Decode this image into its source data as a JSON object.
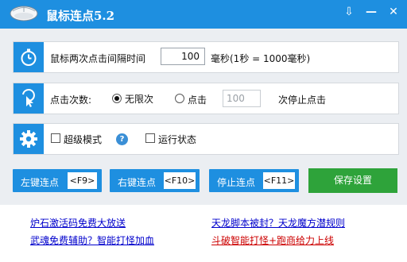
{
  "window": {
    "title": "鼠标连点5.2",
    "controls": {
      "pin": "⇩",
      "minimize": "—",
      "close": "✕"
    }
  },
  "interval": {
    "label": "鼠标两次点击间隔时间",
    "value": "100",
    "unit_label": "毫秒(1秒 = 1000毫秒)"
  },
  "clicks": {
    "label": "点击次数:",
    "unlimited_label": "无限次",
    "limited_label": "点击",
    "count_value": "100",
    "suffix_label": "次停止点击",
    "selected": "unlimited"
  },
  "modes": {
    "super_mode_label": "超级模式",
    "help_glyph": "?",
    "run_state_label": "运行状态",
    "super_mode_checked": false,
    "run_state_checked": false
  },
  "buttons": {
    "left": {
      "label": "左键连点",
      "key": "<F9>"
    },
    "right": {
      "label": "右键连点",
      "key": "<F10>"
    },
    "stop": {
      "label": "停止连点",
      "key": "<F11>"
    },
    "save": {
      "label": "保存设置"
    }
  },
  "links": {
    "l1": "炉石激活码免费大放送",
    "l2": "武魂免费辅助？智能打怪加血",
    "r1": "天龙脚本被封？天龙魔方潜规则",
    "r2": "斗破智能打怪+跑商给力上线"
  },
  "colors": {
    "accent": "#1e8fe0",
    "save": "#2ea33a",
    "link_blue": "#0000cc",
    "link_red": "#cc0000"
  },
  "icons": [
    "mouse-icon",
    "stopwatch-icon",
    "cursor-click-icon",
    "gear-icon"
  ]
}
